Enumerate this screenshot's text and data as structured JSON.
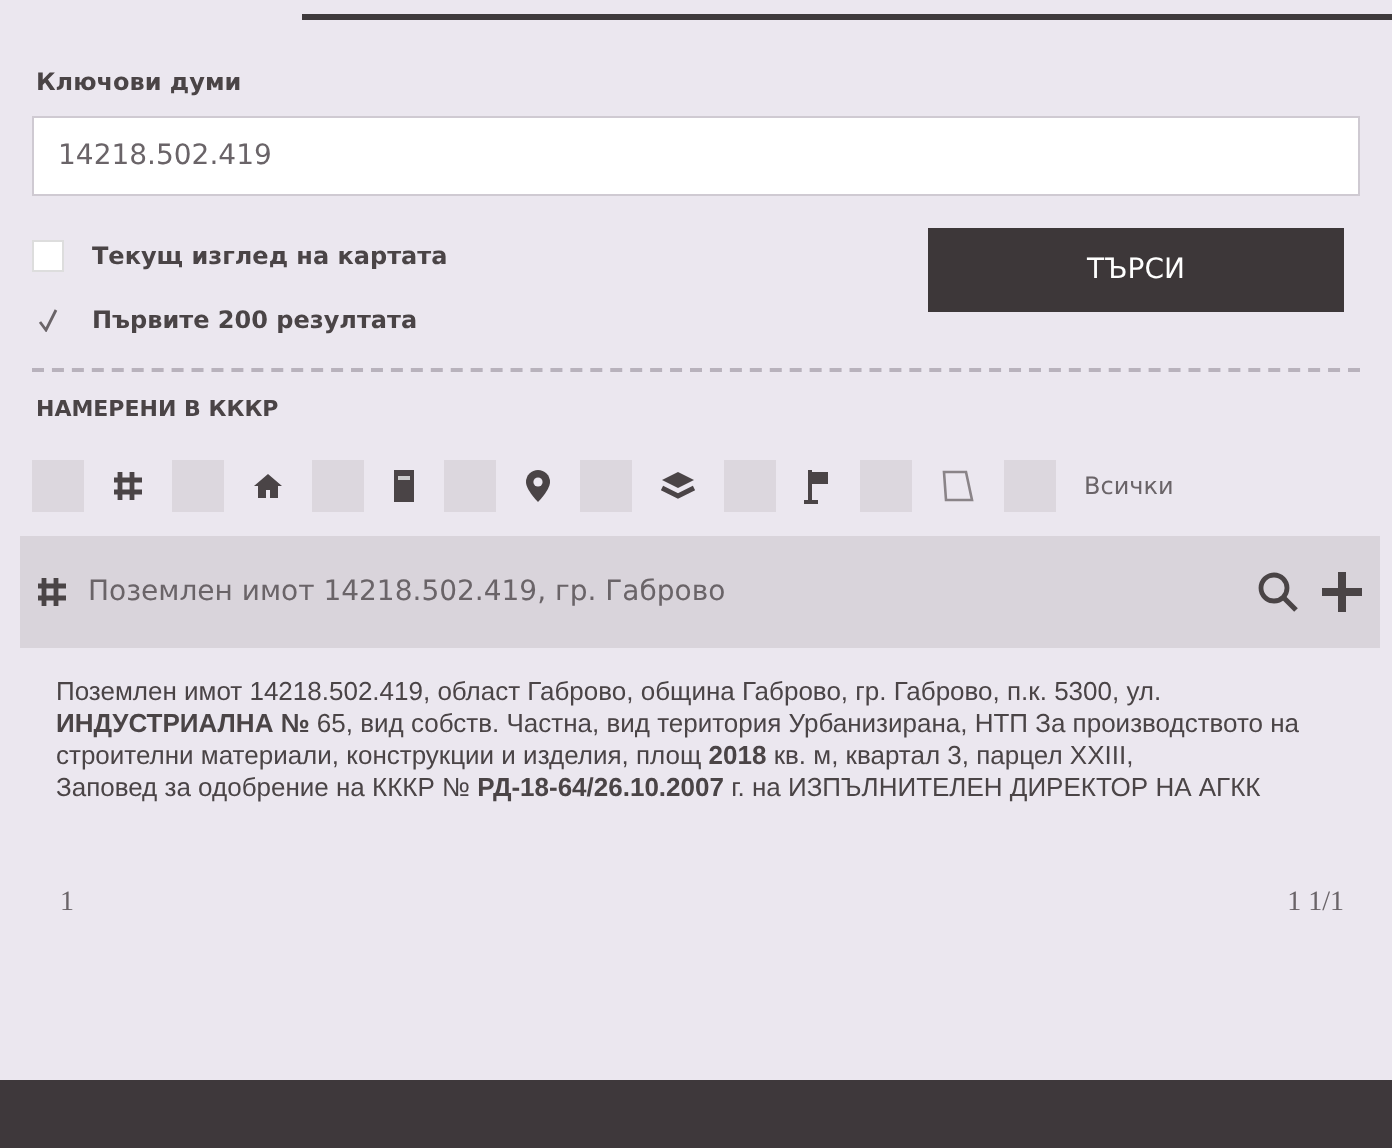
{
  "search": {
    "label": "Ключови думи",
    "value": "14218.502.419",
    "button": "ТЪРСИ"
  },
  "options": [
    {
      "label": "Текущ изглед на картата",
      "checked": false
    },
    {
      "label": "Първите 200 резултата",
      "checked": true
    }
  ],
  "results_heading": "НАМЕРЕНИ В КККР",
  "filters": [
    {
      "kind": "grid",
      "checked": false
    },
    {
      "kind": "house",
      "checked": false
    },
    {
      "kind": "building",
      "checked": false
    },
    {
      "kind": "pin",
      "checked": false
    },
    {
      "kind": "layers",
      "checked": false
    },
    {
      "kind": "flag",
      "checked": false
    },
    {
      "kind": "polygon",
      "checked": false
    },
    {
      "kind": "text",
      "label": "Всички",
      "checked": false
    }
  ],
  "result": {
    "title": "Поземлен имот 14218.502.419, гр. Габрово",
    "description": "Поземлен имот 14218.502.419, област Габрово, община Габрово, гр. Габрово, п.к. 5300, ул. **ИНДУСТРИАЛНА №** 65, вид собств. Частна, вид територия Урбанизирана, НТП За производството на строителни материали, конструкции и изделия, площ **2018** кв. м, квартал 3, парцел XXIII,",
    "order": "Заповед за одобрение на КККР № **РД-18-64/26.10.2007** г. на ИЗПЪЛНИТЕЛЕН ДИРЕКТОР НА АГКК"
  },
  "pagination": {
    "page": "1",
    "summary": "1 1/1"
  }
}
